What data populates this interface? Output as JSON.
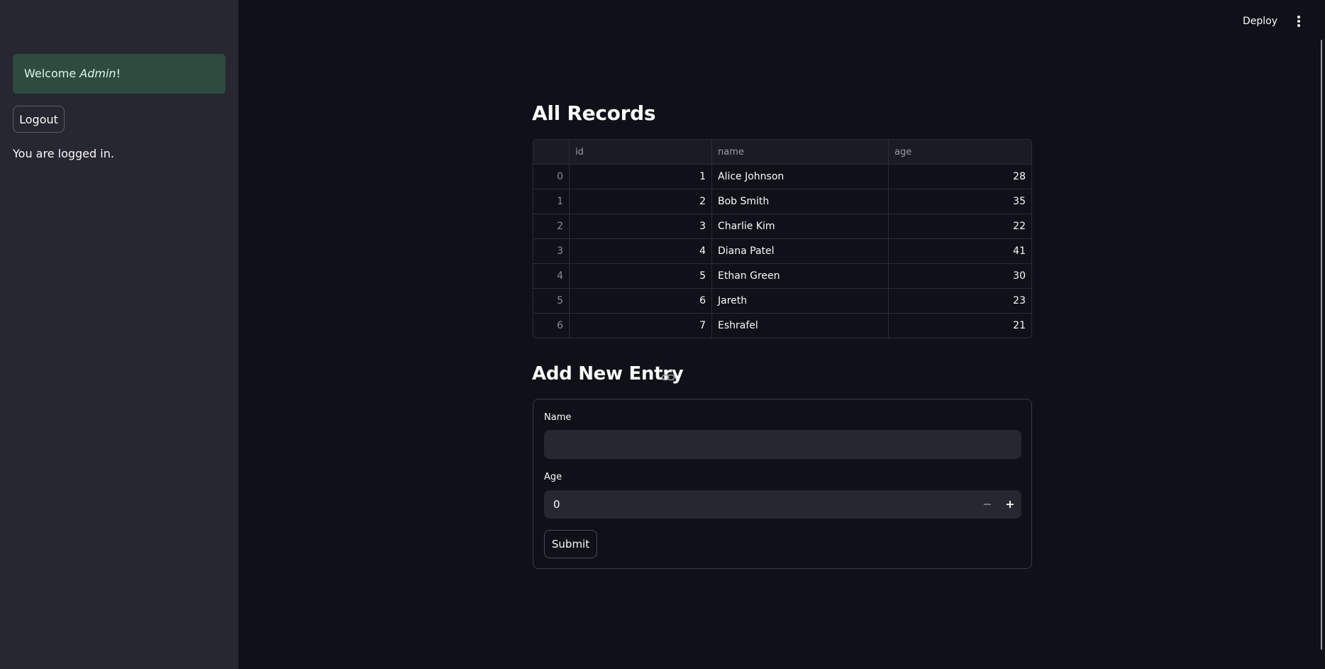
{
  "sidebar": {
    "welcome_prefix": "Welcome ",
    "welcome_user": "Admin",
    "welcome_suffix": "!",
    "logout_label": "Logout",
    "status_text": "You are logged in."
  },
  "header": {
    "deploy_label": "Deploy",
    "menu_icon": "more-vertical-icon"
  },
  "records": {
    "title": "All Records",
    "columns": [
      "",
      "id",
      "name",
      "age"
    ],
    "rows": [
      {
        "index": "0",
        "id": "1",
        "name": "Alice Johnson",
        "age": "28"
      },
      {
        "index": "1",
        "id": "2",
        "name": "Bob Smith",
        "age": "35"
      },
      {
        "index": "2",
        "id": "3",
        "name": "Charlie Kim",
        "age": "22"
      },
      {
        "index": "3",
        "id": "4",
        "name": "Diana Patel",
        "age": "41"
      },
      {
        "index": "4",
        "id": "5",
        "name": "Ethan Green",
        "age": "30"
      },
      {
        "index": "5",
        "id": "6",
        "name": "Jareth",
        "age": "23"
      },
      {
        "index": "6",
        "id": "7",
        "name": "Eshrafel",
        "age": "21"
      }
    ]
  },
  "form": {
    "title": "Add New Entry",
    "anchor_icon": "link-icon",
    "name_label": "Name",
    "name_value": "",
    "age_label": "Age",
    "age_value": "0",
    "minus_label": "−",
    "plus_label": "+",
    "submit_label": "Submit"
  },
  "colors": {
    "background": "#0e1117",
    "sidebar": "#262730",
    "success": "#2d4b3f",
    "text": "#fafafa"
  }
}
